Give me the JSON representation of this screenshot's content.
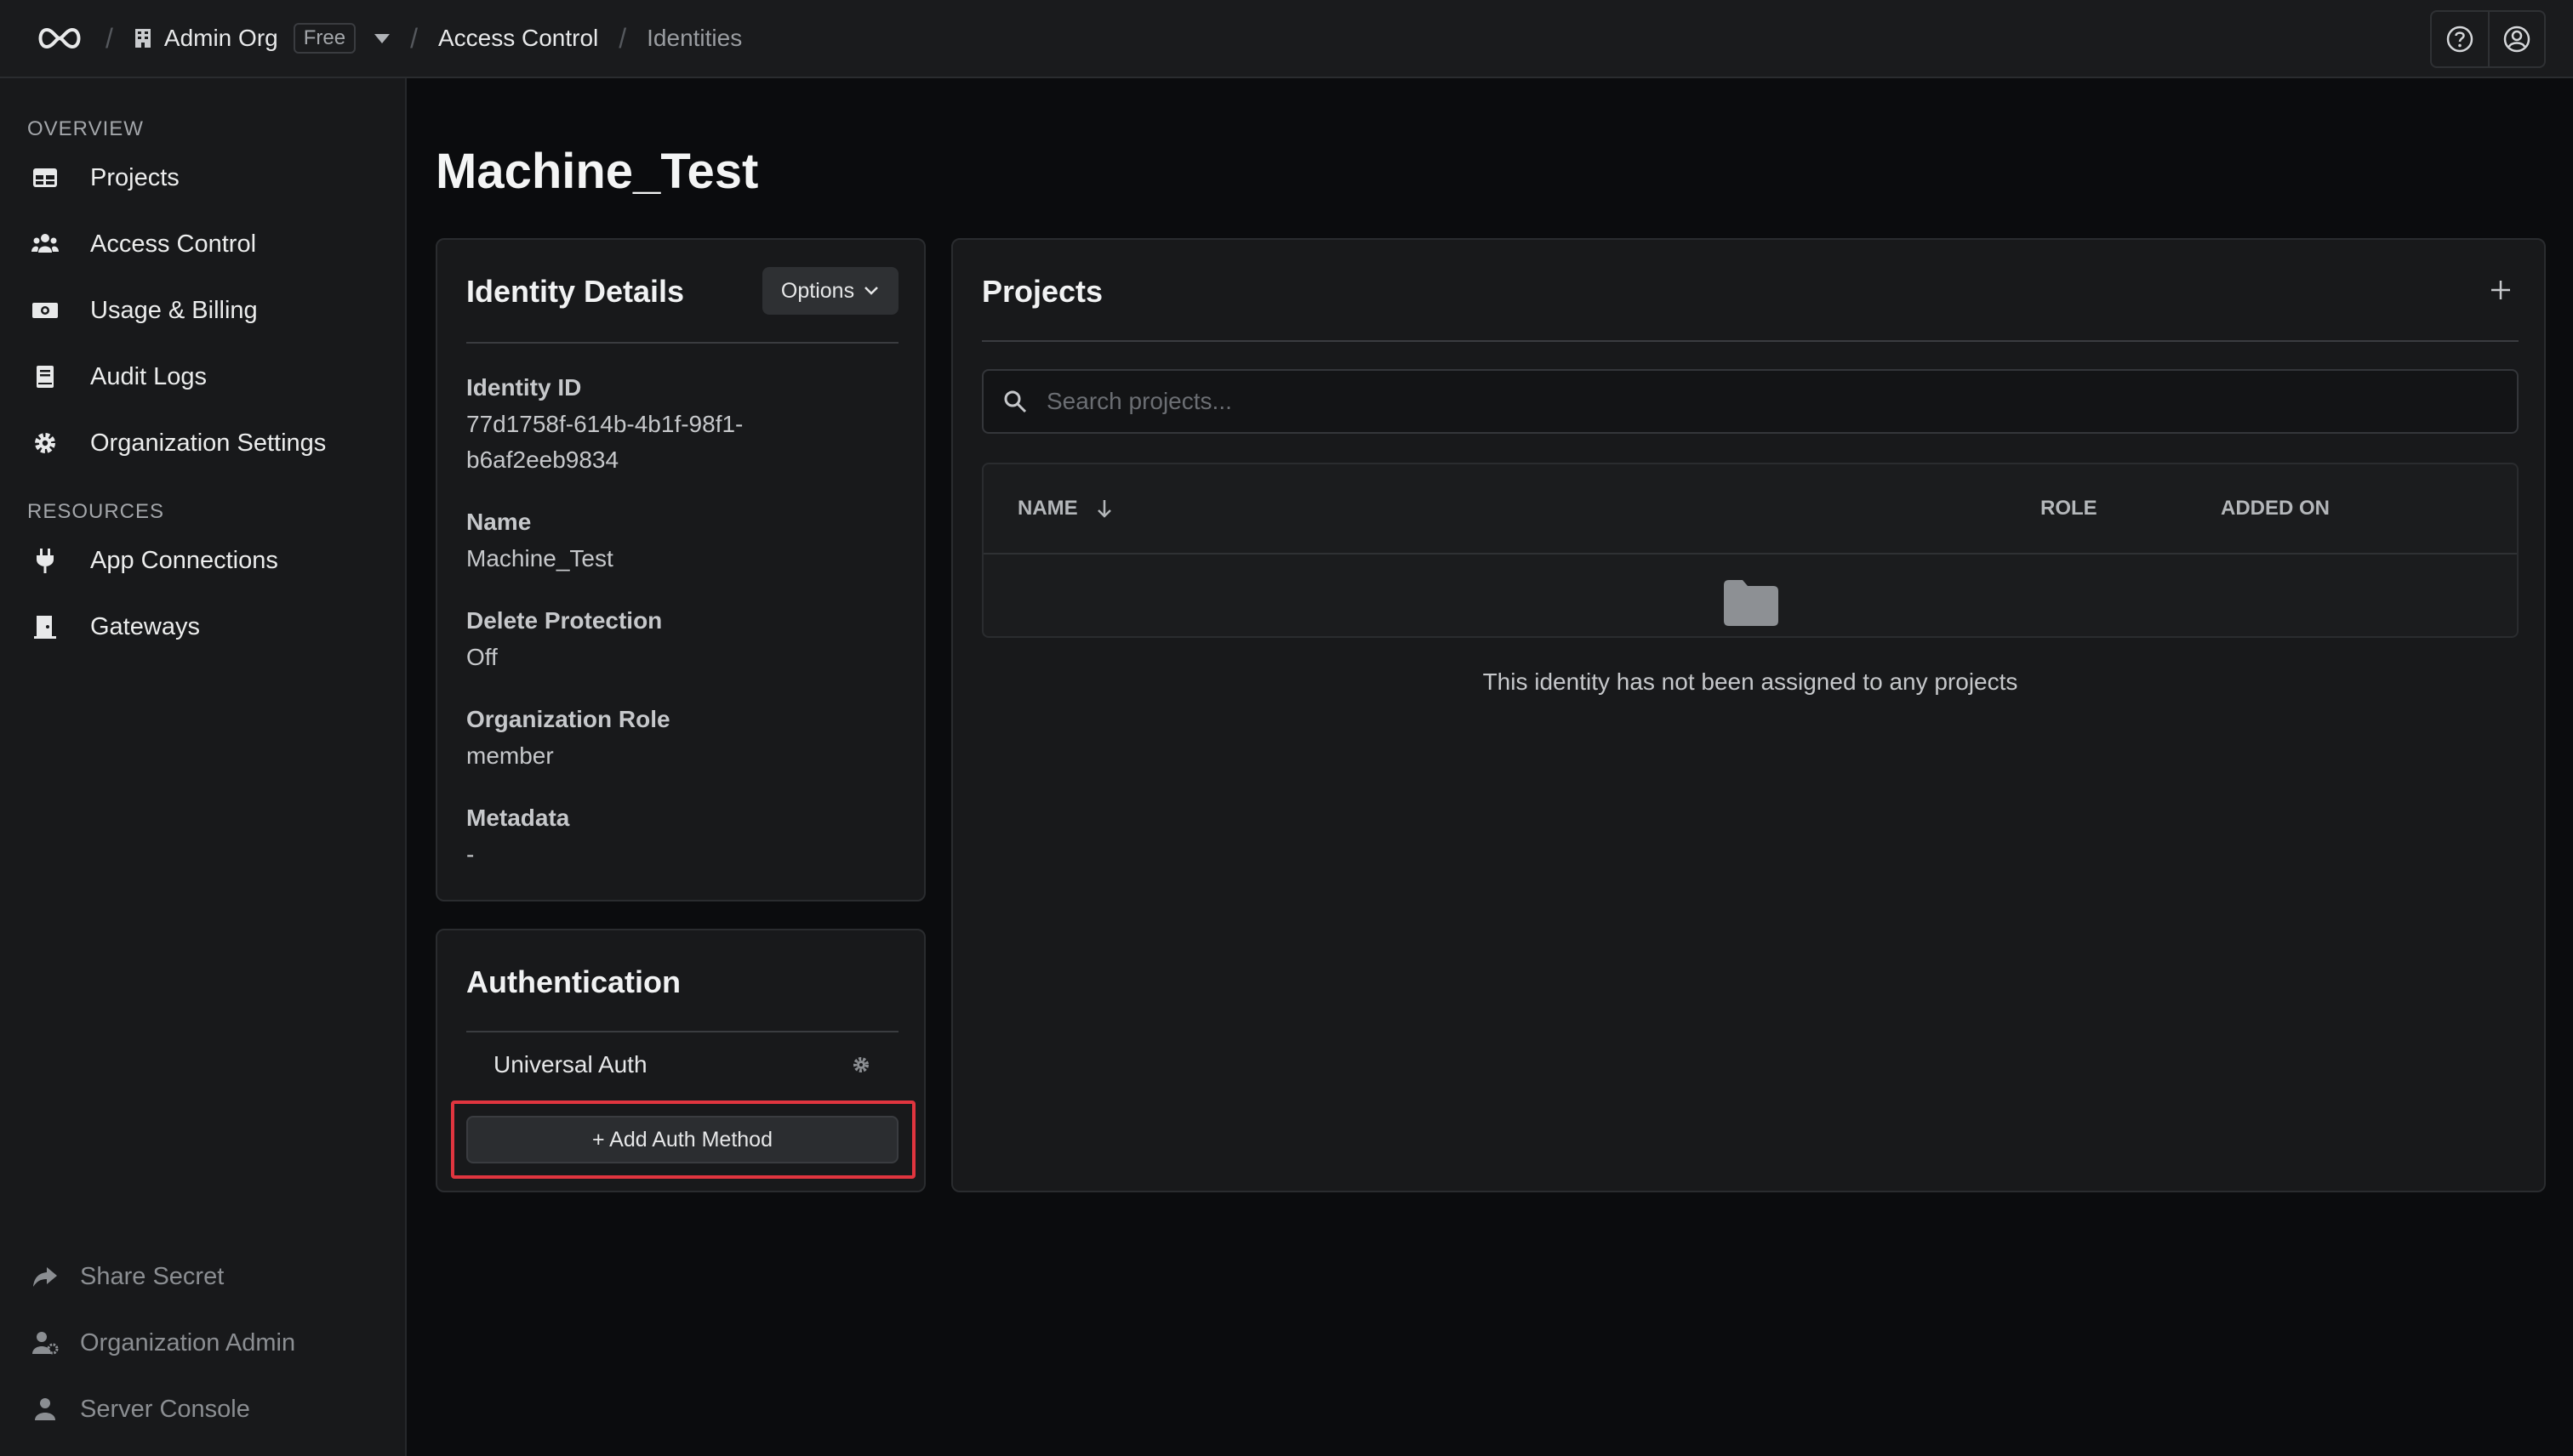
{
  "header": {
    "org_name": "Admin Org",
    "plan_badge": "Free",
    "breadcrumb_section": "Access Control",
    "breadcrumb_page": "Identities"
  },
  "sidebar": {
    "overview_label": "OVERVIEW",
    "resources_label": "RESOURCES",
    "items": [
      {
        "label": "Projects",
        "icon": "table-icon"
      },
      {
        "label": "Access Control",
        "icon": "users-icon"
      },
      {
        "label": "Usage & Billing",
        "icon": "money-icon"
      },
      {
        "label": "Audit Logs",
        "icon": "book-icon"
      },
      {
        "label": "Organization Settings",
        "icon": "gear-icon"
      }
    ],
    "resource_items": [
      {
        "label": "App Connections",
        "icon": "plug-icon"
      },
      {
        "label": "Gateways",
        "icon": "door-icon"
      }
    ],
    "footer_items": [
      {
        "label": "Share Secret",
        "icon": "share-icon"
      },
      {
        "label": "Organization Admin",
        "icon": "user-gear-icon"
      },
      {
        "label": "Server Console",
        "icon": "user-icon"
      }
    ]
  },
  "page": {
    "title": "Machine_Test"
  },
  "identity_details": {
    "title": "Identity Details",
    "options_label": "Options",
    "fields": [
      {
        "label": "Identity ID",
        "value_line1": "77d1758f-614b-4b1f-98f1-",
        "value_line2": "b6af2eeb9834"
      },
      {
        "label": "Name",
        "value": "Machine_Test"
      },
      {
        "label": "Delete Protection",
        "value": "Off"
      },
      {
        "label": "Organization Role",
        "value": "member"
      },
      {
        "label": "Metadata",
        "value": "-"
      }
    ]
  },
  "authentication": {
    "title": "Authentication",
    "methods": [
      {
        "label": "Universal Auth"
      }
    ],
    "add_label": "+ Add Auth Method"
  },
  "projects": {
    "title": "Projects",
    "search_placeholder": "Search projects...",
    "columns": [
      "NAME",
      "ROLE",
      "ADDED ON"
    ],
    "empty_text": "This identity has not been assigned to any projects"
  }
}
